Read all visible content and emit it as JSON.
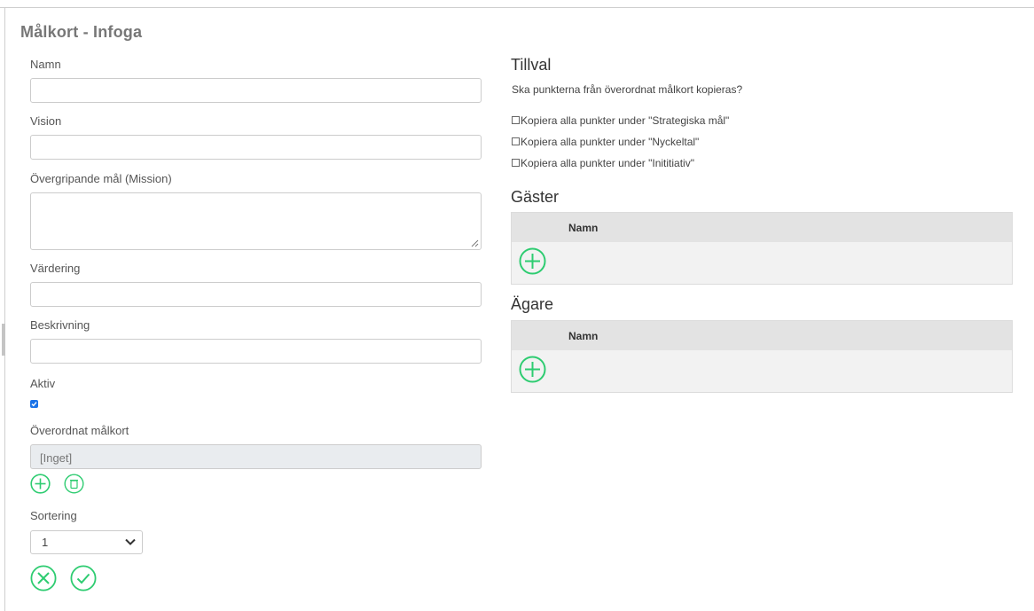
{
  "page": {
    "title": "Målkort - Infoga"
  },
  "form": {
    "name_label": "Namn",
    "name_value": "",
    "vision_label": "Vision",
    "vision_value": "",
    "mission_label": "Övergripande mål (Mission)",
    "mission_value": "",
    "values_label": "Värdering",
    "values_value": "",
    "description_label": "Beskrivning",
    "description_value": "",
    "active_label": "Aktiv",
    "active_checked": true,
    "parent_label": "Överordnat målkort",
    "parent_value": "[Inget]",
    "sort_label": "Sortering",
    "sort_value": "1"
  },
  "options": {
    "title": "Tillval",
    "question": "Ska punkterna från överordnat målkort kopieras?",
    "items": [
      {
        "label": "Kopiera alla punkter under \"Strategiska mål\"",
        "checked": false
      },
      {
        "label": "Kopiera alla punkter under \"Nyckeltal\"",
        "checked": false
      },
      {
        "label": "Kopiera alla punkter under \"Inititiativ\"",
        "checked": false
      }
    ]
  },
  "guests": {
    "title": "Gäster",
    "column_name": "Namn",
    "rows": []
  },
  "owners": {
    "title": "Ägare",
    "column_name": "Namn",
    "rows": []
  },
  "icons": {
    "add": "plus-circle-icon",
    "delete": "trash-circle-icon",
    "cancel": "x-circle-icon",
    "confirm": "check-circle-icon",
    "chevron": "chevron-down-icon"
  },
  "colors": {
    "accent": "#2ecc71",
    "checkbox": "#1a73e8"
  }
}
